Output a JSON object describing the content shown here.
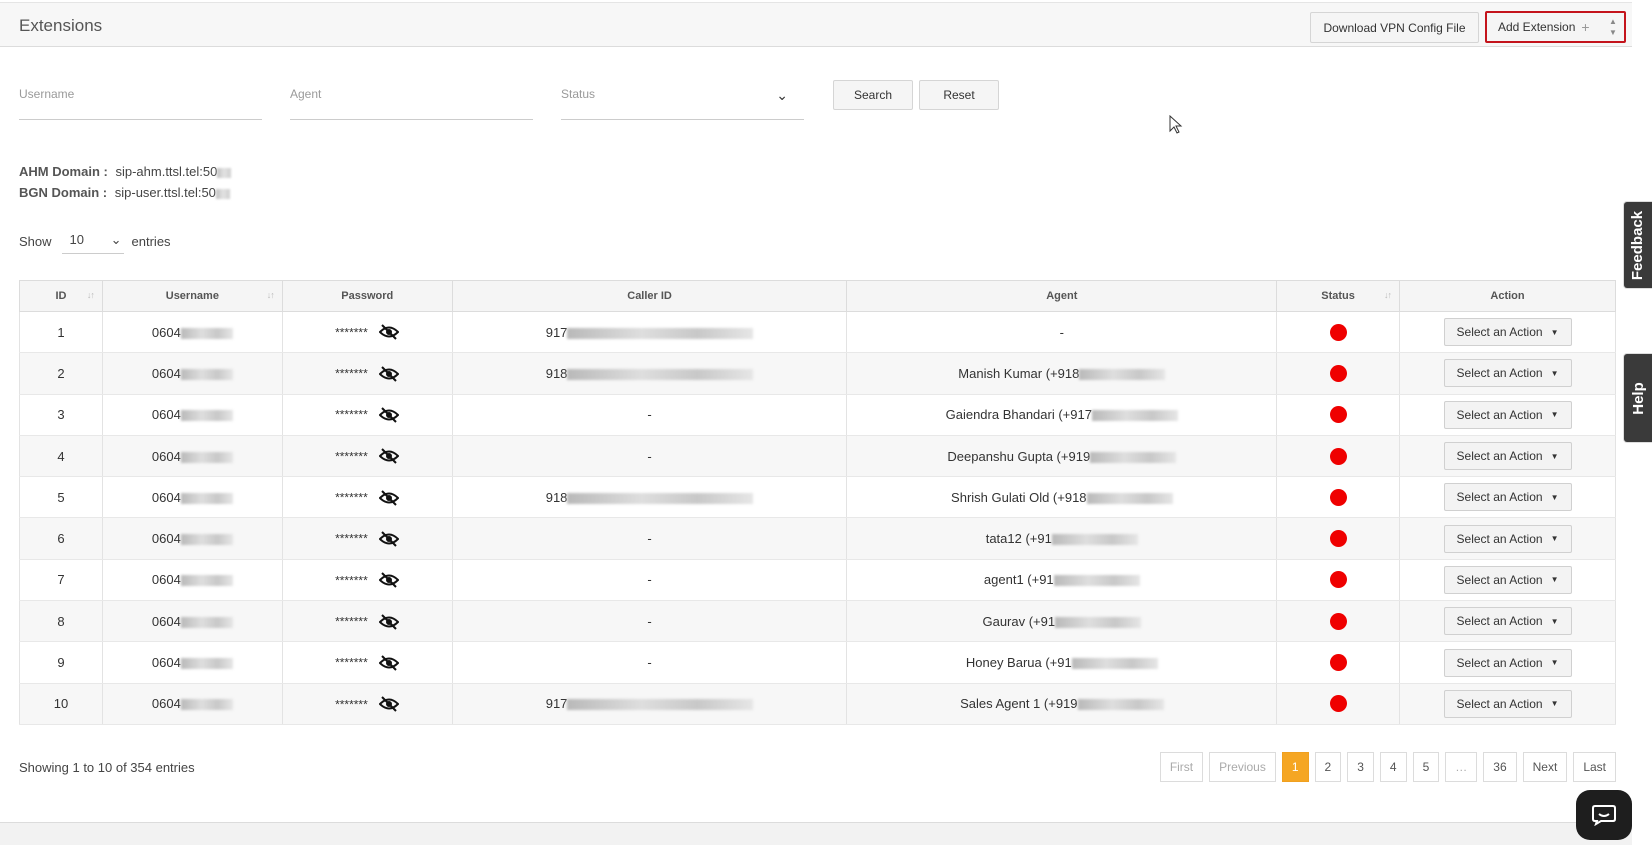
{
  "header": {
    "title": "Extensions",
    "download_vpn_label": "Download VPN Config File",
    "add_extension_label": "Add Extension",
    "add_extension_icon": "+"
  },
  "filters": {
    "username_placeholder": "Username",
    "agent_placeholder": "Agent",
    "status_placeholder": "Status",
    "search_label": "Search",
    "reset_label": "Reset"
  },
  "domains": {
    "ahm_label": "AHM Domain :",
    "ahm_value": "sip-ahm.ttsl.tel:50",
    "bgn_label": "BGN Domain :",
    "bgn_value": "sip-user.ttsl.tel:50"
  },
  "length_menu": {
    "show_label": "Show",
    "value": "10",
    "entries_label": "entries"
  },
  "table": {
    "columns": [
      "ID",
      "Username",
      "Password",
      "Caller ID",
      "Agent",
      "Status",
      "Action"
    ],
    "rows": [
      {
        "id": "1",
        "username": "0604",
        "password": "*******",
        "caller_id": "917",
        "agent": "-",
        "status_color": "#ef0000",
        "action": "Select an Action"
      },
      {
        "id": "2",
        "username": "0604",
        "password": "*******",
        "caller_id": "918",
        "agent": "Manish Kumar (+918",
        "status_color": "#ef0000",
        "action": "Select an Action"
      },
      {
        "id": "3",
        "username": "0604",
        "password": "*******",
        "caller_id": "-",
        "agent": "Gaiendra Bhandari (+917",
        "status_color": "#ef0000",
        "action": "Select an Action"
      },
      {
        "id": "4",
        "username": "0604",
        "password": "*******",
        "caller_id": "-",
        "agent": "Deepanshu Gupta (+919",
        "status_color": "#ef0000",
        "action": "Select an Action"
      },
      {
        "id": "5",
        "username": "0604",
        "password": "*******",
        "caller_id": "918",
        "agent": "Shrish Gulati Old (+918",
        "status_color": "#ef0000",
        "action": "Select an Action"
      },
      {
        "id": "6",
        "username": "0604",
        "password": "*******",
        "caller_id": "-",
        "agent": "tata12 (+91",
        "status_color": "#ef0000",
        "action": "Select an Action"
      },
      {
        "id": "7",
        "username": "0604",
        "password": "*******",
        "caller_id": "-",
        "agent": "agent1 (+91",
        "status_color": "#ef0000",
        "action": "Select an Action"
      },
      {
        "id": "8",
        "username": "0604",
        "password": "*******",
        "caller_id": "-",
        "agent": "Gaurav (+91",
        "status_color": "#ef0000",
        "action": "Select an Action"
      },
      {
        "id": "9",
        "username": "0604",
        "password": "*******",
        "caller_id": "-",
        "agent": "Honey Barua (+91",
        "status_color": "#ef0000",
        "action": "Select an Action"
      },
      {
        "id": "10",
        "username": "0604",
        "password": "*******",
        "caller_id": "917",
        "agent": "Sales Agent 1 (+919",
        "status_color": "#ef0000",
        "action": "Select an Action"
      }
    ]
  },
  "footer": {
    "info": "Showing 1 to 10 of 354 entries",
    "pagination": [
      "First",
      "Previous",
      "1",
      "2",
      "3",
      "4",
      "5",
      "…",
      "36",
      "Next",
      "Last"
    ],
    "active_page": "1"
  },
  "side_tabs": {
    "feedback": "Feedback",
    "help": "Help"
  },
  "colors": {
    "accent_red": "#c4141c",
    "status_offline": "#ef0000",
    "pagination_active": "#f5a623"
  }
}
